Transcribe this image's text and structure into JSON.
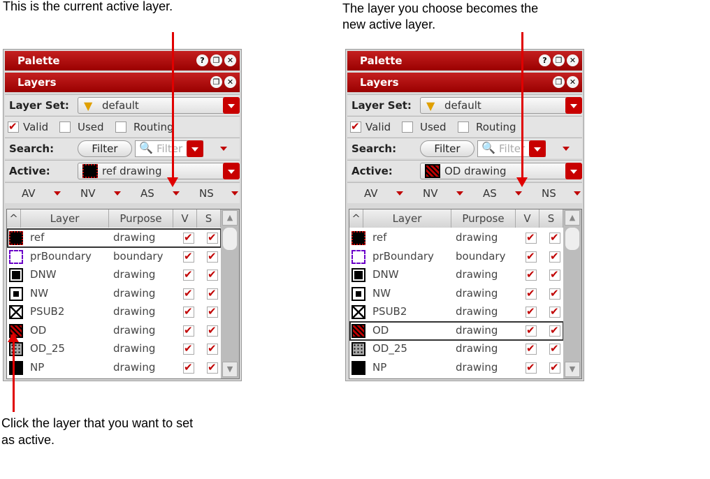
{
  "captions": {
    "top_left": "This is the current active layer.",
    "top_right_1": "The layer you choose becomes the",
    "top_right_2": "new active layer.",
    "bottom_left_1": "Click the layer that you want to set",
    "bottom_left_2": "as active."
  },
  "panels": [
    {
      "palette_title": "Palette",
      "layers_title": "Layers",
      "layer_set_label": "Layer Set:",
      "layer_set_value": "default",
      "valid_label": "Valid",
      "used_label": "Used",
      "routing_label": "Routing",
      "search_label": "Search:",
      "filter_button": "Filter",
      "search_placeholder": "Filter",
      "active_label": "Active:",
      "active_value": "ref drawing",
      "av": "AV",
      "nv": "NV",
      "as": "AS",
      "ns": "NS",
      "col_layer": "Layer",
      "col_purpose": "Purpose",
      "col_v": "V",
      "col_s": "S",
      "selected_row": 0
    },
    {
      "palette_title": "Palette",
      "layers_title": "Layers",
      "layer_set_label": "Layer Set:",
      "layer_set_value": "default",
      "valid_label": "Valid",
      "used_label": "Used",
      "routing_label": "Routing",
      "search_label": "Search:",
      "filter_button": "Filter",
      "search_placeholder": "Filter",
      "active_label": "Active:",
      "active_value": "OD drawing",
      "av": "AV",
      "nv": "NV",
      "as": "AS",
      "ns": "NS",
      "col_layer": "Layer",
      "col_purpose": "Purpose",
      "col_v": "V",
      "col_s": "S",
      "selected_row": 5
    }
  ],
  "layers": [
    {
      "name": "ref",
      "purpose": "drawing"
    },
    {
      "name": "prBoundary",
      "purpose": "boundary"
    },
    {
      "name": "DNW",
      "purpose": "drawing"
    },
    {
      "name": "NW",
      "purpose": "drawing"
    },
    {
      "name": "PSUB2",
      "purpose": "drawing"
    },
    {
      "name": "OD",
      "purpose": "drawing"
    },
    {
      "name": "OD_25",
      "purpose": "drawing"
    },
    {
      "name": "NP",
      "purpose": "drawing"
    }
  ],
  "colors": {
    "accent": "#c00000",
    "arrow": "#e00000"
  }
}
